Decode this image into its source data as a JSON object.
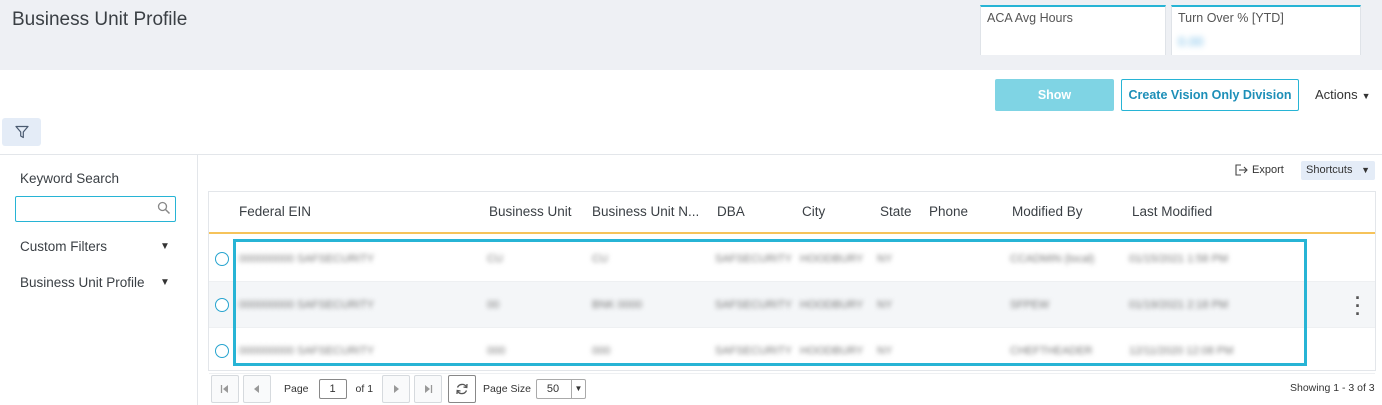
{
  "header": {
    "title": "Business Unit Profile",
    "kpis": [
      {
        "label": "ACA Avg Hours",
        "value": ""
      },
      {
        "label": "Turn Over % [YTD]",
        "value": "0.00"
      }
    ]
  },
  "toolbar": {
    "show_label": "Show",
    "create_label": "Create Vision Only Division",
    "actions_label": "Actions"
  },
  "sidebar": {
    "keyword_label": "Keyword Search",
    "keyword_value": "",
    "custom_filters_label": "Custom Filters",
    "profile_label": "Business Unit Profile"
  },
  "grid_tools": {
    "export_label": "Export",
    "shortcuts_label": "Shortcuts"
  },
  "table": {
    "columns": [
      "Federal EIN",
      "Business Unit",
      "Business Unit N...",
      "DBA",
      "City",
      "State",
      "Phone",
      "Modified By",
      "Last Modified"
    ],
    "rows": [
      [
        "000000000 SAFSECURITY",
        "CU",
        "CU",
        "SAFSECURITY",
        "HOODBURY",
        "NY",
        "",
        "CCADMIN (local)",
        "01/15/2021 1:58 PM"
      ],
      [
        "000000000 SAFSECURITY",
        "00",
        "BNK 0000",
        "SAFSECURITY",
        "HOODBURY",
        "NY",
        "",
        "SFPEW",
        "01/19/2021 2:18 PM"
      ],
      [
        "000000000 SAFSECURITY",
        "000",
        "000",
        "SAFSECURITY",
        "HOODBURY",
        "NY",
        "",
        "CHEFTHEADER",
        "12/11/2020 12:08 PM"
      ]
    ]
  },
  "pager": {
    "page_label": "Page",
    "page_value": "1",
    "of_label": "of 1",
    "size_label": "Page Size",
    "size_value": "50",
    "showing": "Showing 1 - 3 of 3"
  },
  "colors": {
    "accent": "#27b4d5",
    "header_underline": "#f6c35a"
  }
}
